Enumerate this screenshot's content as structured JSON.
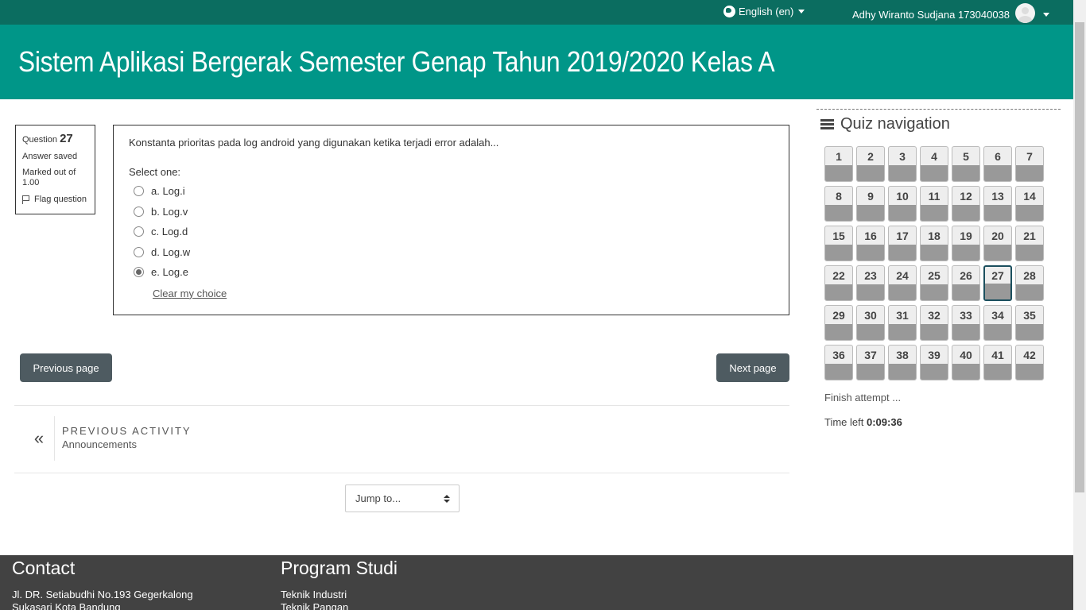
{
  "topbar": {
    "language": "English (en)",
    "user_name": "Adhy Wiranto Sudjana 173040038"
  },
  "course_title": "Sistem Aplikasi Bergerak Semester Genap Tahun 2019/2020 Kelas A",
  "question_info": {
    "label": "Question",
    "number": "27",
    "state": "Answer saved",
    "marked": "Marked out of 1.00",
    "flag_label": "Flag question"
  },
  "question": {
    "text": "Konstanta prioritas pada log android yang digunakan ketika terjadi error adalah...",
    "prompt": "Select one:",
    "options": [
      {
        "label": "a. Log.i",
        "checked": false
      },
      {
        "label": "b. Log.v",
        "checked": false
      },
      {
        "label": "c. Log.d",
        "checked": false
      },
      {
        "label": "d. Log.w",
        "checked": false
      },
      {
        "label": "e. Log.e",
        "checked": true
      }
    ],
    "clear_label": "Clear my choice"
  },
  "buttons": {
    "previous": "Previous page",
    "next": "Next page"
  },
  "previous_activity": {
    "label": "PREVIOUS ACTIVITY",
    "name": "Announcements",
    "icon": "double-chevron-left-icon"
  },
  "jump": {
    "label": "Jump to..."
  },
  "quiz_nav": {
    "title": "Quiz navigation",
    "total": 42,
    "current": 27,
    "finish_label": "Finish attempt ...",
    "time_label": "Time left",
    "time_value": "0:09:36"
  },
  "footer": {
    "contact_title": "Contact",
    "contact_lines": [
      "Jl. DR. Setiabudhi No.193 Gegerkalong",
      "Sukasari Kota Bandung"
    ],
    "program_title": "Program Studi",
    "program_lines": [
      "Teknik Industri",
      "Teknik Pangan"
    ]
  },
  "colors": {
    "topbar": "#0b6d60",
    "banner": "#009688",
    "button": "#4e5b61",
    "footer": "#424242"
  }
}
